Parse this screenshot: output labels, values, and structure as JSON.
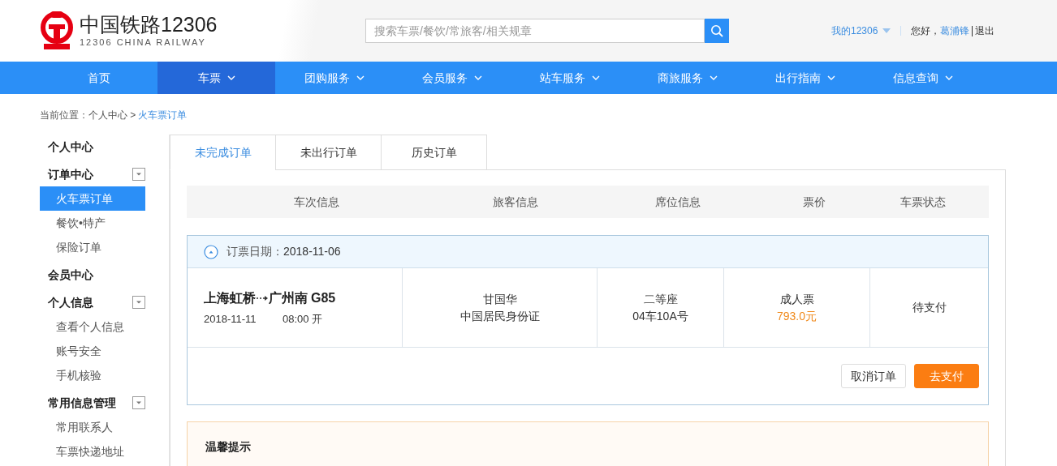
{
  "header": {
    "logo": {
      "title": "中国铁路12306",
      "subtitle": "12306 CHINA RAILWAY"
    },
    "search": {
      "placeholder": "搜索车票/餐饮/常旅客/相关规章"
    },
    "account": {
      "menu": "我的12306",
      "greeting": "您好，",
      "username": "葛浦锋",
      "logout": "退出"
    }
  },
  "nav": [
    {
      "label": "首页",
      "selected": false,
      "has_menu": false
    },
    {
      "label": "车票",
      "selected": true,
      "has_menu": true
    },
    {
      "label": "团购服务",
      "selected": false,
      "has_menu": true
    },
    {
      "label": "会员服务",
      "selected": false,
      "has_menu": true
    },
    {
      "label": "站车服务",
      "selected": false,
      "has_menu": true
    },
    {
      "label": "商旅服务",
      "selected": false,
      "has_menu": true
    },
    {
      "label": "出行指南",
      "selected": false,
      "has_menu": true
    },
    {
      "label": "信息查询",
      "selected": false,
      "has_menu": true
    }
  ],
  "breadcrumb": {
    "path": "当前位置：个人中心 >",
    "current": "火车票订单"
  },
  "sidebar": [
    {
      "label": "个人中心",
      "collapsible": false
    },
    {
      "label": "订单中心",
      "collapsible": true,
      "children": [
        {
          "label": "火车票订单",
          "selected": true
        },
        {
          "label": "餐饮•特产",
          "selected": false
        },
        {
          "label": "保险订单",
          "selected": false
        }
      ]
    },
    {
      "label": "会员中心",
      "collapsible": false
    },
    {
      "label": "个人信息",
      "collapsible": true,
      "children": [
        {
          "label": "查看个人信息",
          "selected": false
        },
        {
          "label": "账号安全",
          "selected": false
        },
        {
          "label": "手机核验",
          "selected": false
        }
      ]
    },
    {
      "label": "常用信息管理",
      "collapsible": true,
      "children": [
        {
          "label": "常用联系人",
          "selected": false
        },
        {
          "label": "车票快递地址",
          "selected": false
        }
      ]
    }
  ],
  "tabs": [
    {
      "label": "未完成订单",
      "selected": true
    },
    {
      "label": "未出行订单",
      "selected": false
    },
    {
      "label": "历史订单",
      "selected": false
    }
  ],
  "table": {
    "columns": [
      "车次信息",
      "旅客信息",
      "席位信息",
      "票价",
      "车票状态"
    ]
  },
  "orders": [
    {
      "date_label": "订票日期：",
      "date": "2018-11-06",
      "expanded": true,
      "from": "上海虹桥",
      "to": "广州南",
      "train": "G85",
      "travel_date": "2018-11-11",
      "departure": "08:00 开",
      "passenger": "甘国华",
      "id_type": "中国居民身份证",
      "seat_class": "二等座",
      "seat": "04车10A号",
      "ticket_type": "成人票",
      "price": "793.0元",
      "status": "待支付",
      "actions": [
        {
          "label": "取消订单",
          "kind": "secondary"
        },
        {
          "label": "去支付",
          "kind": "primary"
        }
      ]
    }
  ],
  "notice": {
    "title": "温馨提示"
  }
}
